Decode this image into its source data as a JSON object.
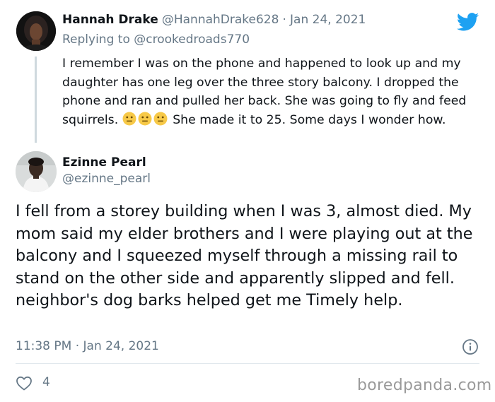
{
  "reply_tweet": {
    "author_name": "Hannah Drake",
    "author_handle": "@HannahDrake628",
    "separator": "·",
    "date": "Jan 24, 2021",
    "replying_to_prefix": "Replying to",
    "replying_to_handle": "@crookedroads770",
    "text_part1": "I remember I was on the phone and happened to look up and my daughter has one leg over the three story balcony. I dropped the phone and ran and pulled her back. She was going to fly and feed squirrels.",
    "emojis": [
      "neutral-face-emoji",
      "neutral-face-emoji",
      "neutral-face-emoji"
    ],
    "text_part2": "She made it to 25. Some days I wonder how."
  },
  "main_tweet": {
    "author_name": "Ezinne Pearl",
    "author_handle": "@ezinne_pearl",
    "text": "I fell from a storey building when I was 3, almost died. My mom said my elder brothers and I were playing out at the balcony and I squeezed myself through a missing rail to stand on the other side and apparently slipped and fell. neighbor's dog barks helped get me Timely help.",
    "time": "11:38 PM",
    "separator": "·",
    "date": "Jan 24, 2021",
    "like_count": "4"
  },
  "watermark": "boredpanda.com",
  "icons": {
    "brand": "twitter-bird-icon",
    "info": "info-icon",
    "like": "heart-icon"
  },
  "colors": {
    "twitter_blue": "#1da1f2",
    "muted_text": "#657786",
    "primary_text": "#0f1419",
    "thread_line": "#cfd9de",
    "emoji_yellow": "#f7c948"
  }
}
